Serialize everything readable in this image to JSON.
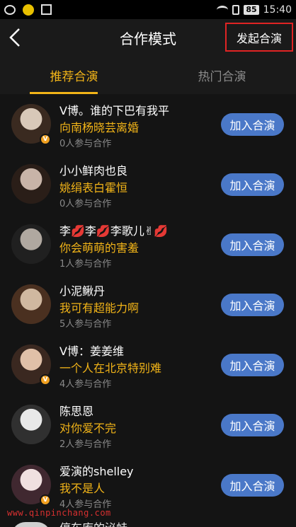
{
  "status_bar": {
    "battery": "85",
    "time": "15:40",
    "icons": [
      "weibo-icon",
      "coin-icon",
      "scan-icon",
      "wifi-icon",
      "sim-icon",
      "battery-icon"
    ]
  },
  "nav": {
    "title": "合作模式",
    "start_button": "发起合演",
    "highlight_color": "#e02424"
  },
  "tabs": [
    {
      "label": "推荐合演",
      "active": true
    },
    {
      "label": "热门合演",
      "active": false
    }
  ],
  "colors": {
    "accent": "#f2b418",
    "button": "#4a78c8",
    "background": "#141414"
  },
  "rows": [
    {
      "name": "V博。谁的下巴有我平",
      "song": "向南杨晓芸离婚",
      "count": "0人参与合作",
      "button": "加入合演",
      "verified": true
    },
    {
      "name": "小小鲜肉也良",
      "song": "姚绢表白霍恒",
      "count": "0人参与合作",
      "button": "加入合演",
      "verified": false
    },
    {
      "name": "李💋李💋李歌儿✌💋",
      "song": "你会萌萌的害羞",
      "count": "1人参与合作",
      "button": "加入合演",
      "verified": false
    },
    {
      "name": "小泥鳅丹",
      "song": "我可有超能力啊",
      "count": "5人参与合作",
      "button": "加入合演",
      "verified": false
    },
    {
      "name": "V博：姜姜维",
      "song": "一个人在北京特别难",
      "count": "4人参与合作",
      "button": "加入合演",
      "verified": true
    },
    {
      "name": "陈思恩",
      "song": "对你爱不完",
      "count": "2人参与合作",
      "button": "加入合演",
      "verified": false
    },
    {
      "name": "爱演的shelley",
      "song": "我不是人",
      "count": "4人参与合作",
      "button": "加入合演",
      "verified": true
    }
  ],
  "peek_row_name": "停车库的泌蛙",
  "watermark": "www.qinpinchang.com"
}
